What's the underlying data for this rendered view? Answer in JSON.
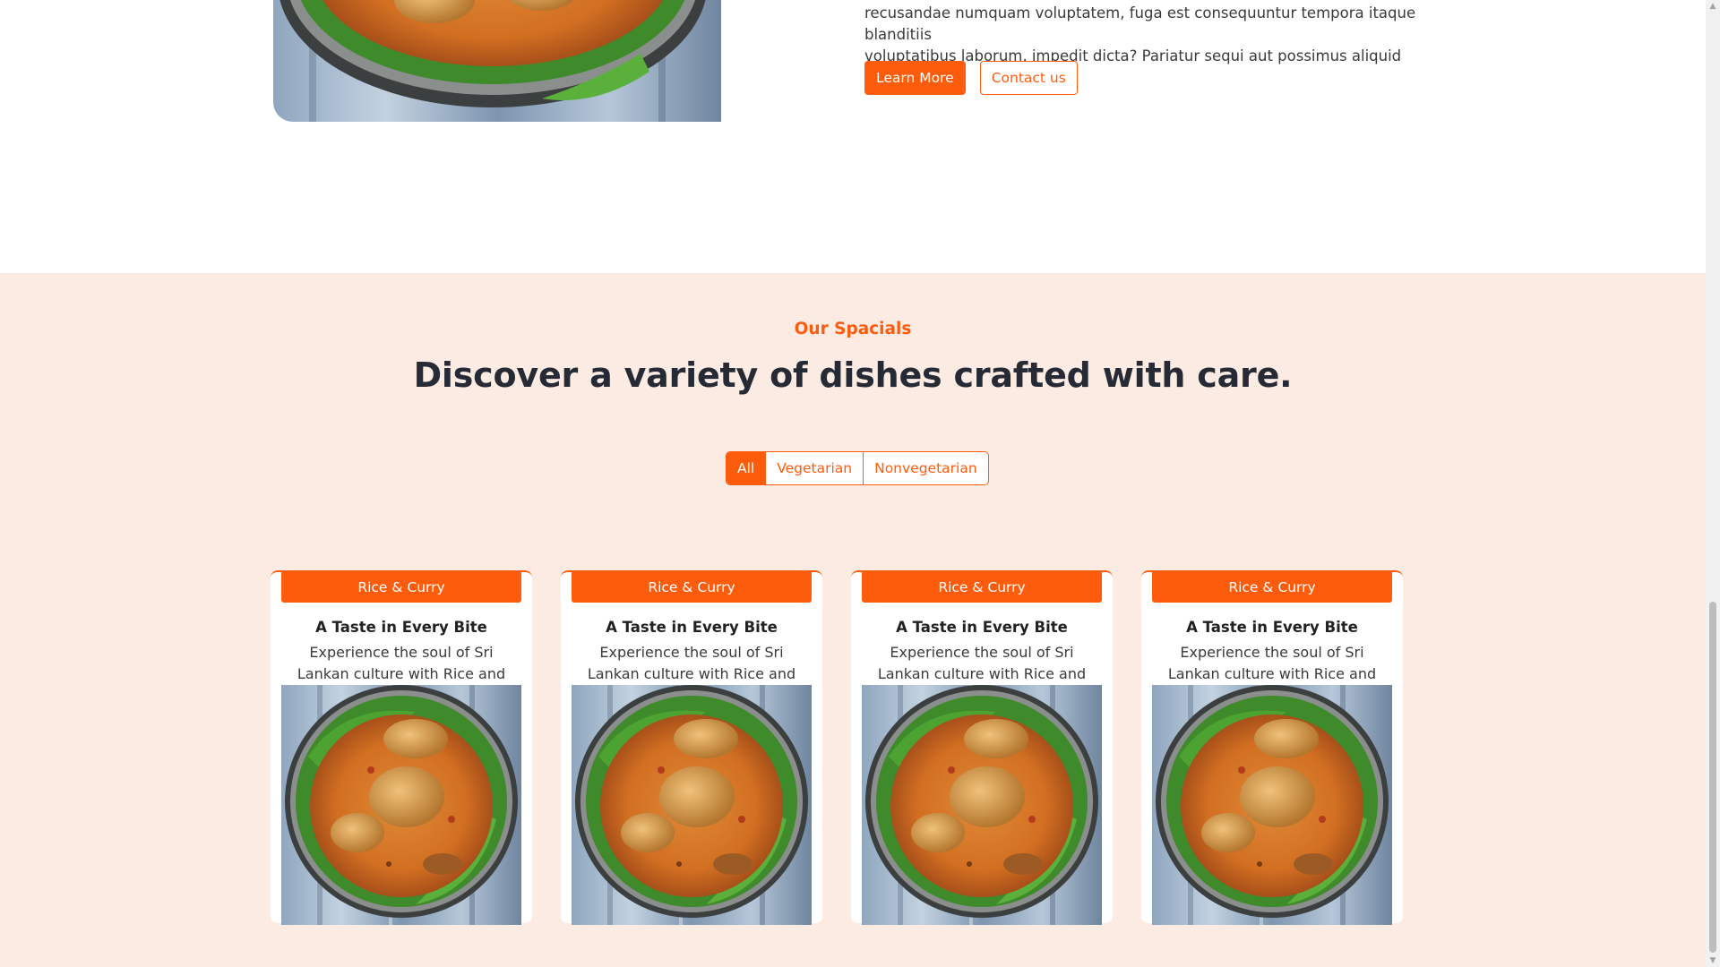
{
  "about": {
    "paragraph_line1": "recusandae numquam voluptatem, fuga est consequuntur tempora itaque blanditiis",
    "paragraph_line2": "voluptatibus laborum, impedit dicta? Pariatur sequi aut possimus aliquid voluptatibus.",
    "learn_more_label": "Learn More",
    "contact_label": "Contact us"
  },
  "specials": {
    "eyebrow": "Our Spacials",
    "headline": "Discover a variety of dishes crafted with care.",
    "filters": [
      {
        "label": "All",
        "active": true
      },
      {
        "label": "Vegetarian",
        "active": false
      },
      {
        "label": "Nonvegetarian",
        "active": false
      }
    ],
    "cards": [
      {
        "badge": "Rice & Curry",
        "title": "A Taste in Every Bite",
        "description": "Experience the soul of Sri Lankan culture with Rice and Curry"
      },
      {
        "badge": "Rice & Curry",
        "title": "A Taste in Every Bite",
        "description": "Experience the soul of Sri Lankan culture with Rice and Curry"
      },
      {
        "badge": "Rice & Curry",
        "title": "A Taste in Every Bite",
        "description": "Experience the soul of Sri Lankan culture with Rice and Curry"
      },
      {
        "badge": "Rice & Curry",
        "title": "A Taste in Every Bite",
        "description": "Experience the soul of Sri Lankan culture with Rice and Curry"
      }
    ]
  },
  "colors": {
    "accent": "#fe5c0d",
    "section_bg": "#fbebe3",
    "heading": "#252a34"
  },
  "icons": {
    "scroll_up": "scroll-up-arrow-icon",
    "scroll_down": "scroll-down-arrow-icon"
  }
}
